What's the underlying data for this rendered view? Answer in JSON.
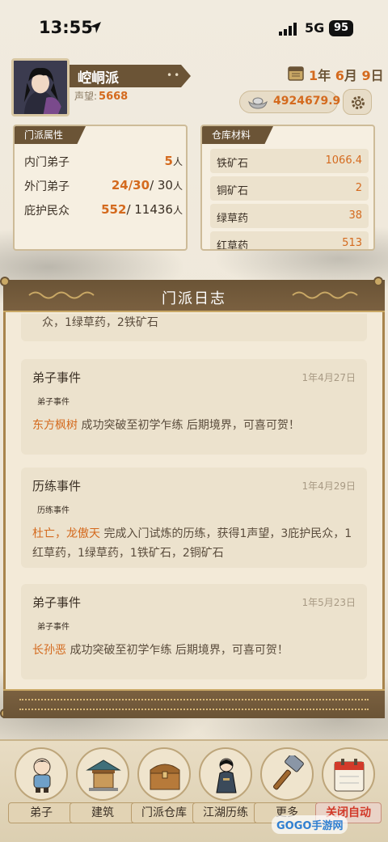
{
  "status_bar": {
    "time": "13:55",
    "network": "5G",
    "battery": "95"
  },
  "header": {
    "sect_name": "崆峒派",
    "prestige_label": "声望:",
    "prestige_value": "5668",
    "date": {
      "year": "1",
      "year_unit": "年",
      "month": "6",
      "month_unit": "月",
      "day": "9",
      "day_unit": "日"
    },
    "silver": "4924679.9"
  },
  "sect_attributes": {
    "title": "门派属性",
    "rows": [
      {
        "label": "内门弟子",
        "value": "5",
        "unit": "人"
      },
      {
        "label": "外门弟子",
        "value": "24/30",
        "max": "/ 30",
        "unit": "人"
      },
      {
        "label": "庇护民众",
        "value": "552",
        "max": "/ 11436",
        "unit": "人"
      }
    ]
  },
  "warehouse": {
    "title": "仓库材料",
    "rows": [
      {
        "label": "铁矿石",
        "value": "1066.4"
      },
      {
        "label": "铜矿石",
        "value": "2"
      },
      {
        "label": "绿草药",
        "value": "38"
      },
      {
        "label": "红草药",
        "value": "513"
      }
    ]
  },
  "log": {
    "title": "门派日志",
    "partial_text": "众，1绿草药，2铁矿石",
    "cards": [
      {
        "kind": "弟子事件",
        "date": "1年4月27日",
        "tag": "弟子事件",
        "who": "东方枫树",
        "text": " 成功突破至初学乍练 后期境界，可喜可贺！"
      },
      {
        "kind": "历练事件",
        "date": "1年4月29日",
        "tag": "历练事件",
        "who": "杜亡，龙傲天",
        "text": " 完成入门试炼的历练，获得1声望，3庇护民众，1红草药，1绿草药，1铁矿石，2铜矿石"
      },
      {
        "kind": "弟子事件",
        "date": "1年5月23日",
        "tag": "弟子事件",
        "who": "长孙恶",
        "text": " 成功突破至初学乍练 后期境界，可喜可贺！"
      }
    ]
  },
  "nav": [
    {
      "label": "弟子",
      "icon": "disciple-icon"
    },
    {
      "label": "建筑",
      "icon": "building-icon"
    },
    {
      "label": "门派仓库",
      "icon": "chest-icon"
    },
    {
      "label": "江湖历练",
      "icon": "swordsman-icon"
    },
    {
      "label": "更多",
      "icon": "hammer-icon"
    },
    {
      "label": "关闭自动",
      "icon": "calendar-icon"
    }
  ],
  "watermark": "GOGO手游网",
  "colors": {
    "accent": "#d46a1e",
    "frame_brown": "#6b5436",
    "gold": "#c9a865"
  }
}
